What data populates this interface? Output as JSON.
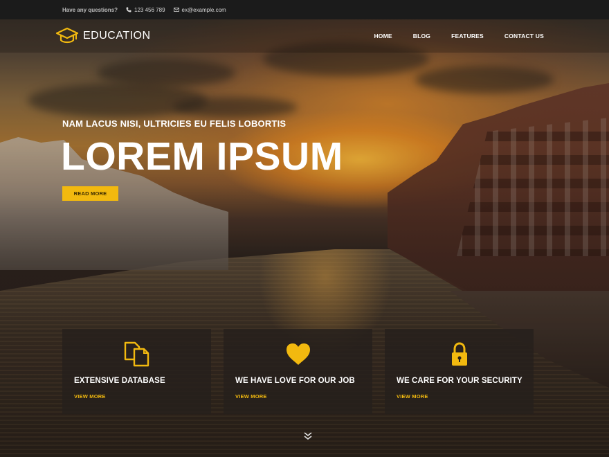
{
  "topbar": {
    "question": "Have any questions?",
    "phone": "123 456 789",
    "email": "ex@example.com",
    "icons": [
      "phone-icon",
      "envelope-icon"
    ]
  },
  "nav": {
    "brand": "EDUCATION",
    "brand_icon": "graduation-cap-icon",
    "items": [
      {
        "label": "HOME"
      },
      {
        "label": "BLOG"
      },
      {
        "label": "FEATURES"
      },
      {
        "label": "CONTACT US"
      }
    ]
  },
  "hero": {
    "subtitle": "NAM LACUS NISI, ULTRICIES EU FELIS LOBORTIS",
    "title": "LOREM IPSUM",
    "button": "READ MORE"
  },
  "features": [
    {
      "icon": "documents-icon",
      "title": "EXTENSIVE DATABASE",
      "link": "VIEW MORE"
    },
    {
      "icon": "heart-icon",
      "title": "WE HAVE LOVE FOR OUR JOB",
      "link": "VIEW MORE"
    },
    {
      "icon": "lock-icon",
      "title": "WE CARE FOR YOUR SECURITY",
      "link": "VIEW MORE"
    }
  ],
  "scroll_icon": "chevron-double-down-icon",
  "colors": {
    "accent": "#f2b90f",
    "topbar": "#1b1b1b",
    "feature_box": "#26201c"
  }
}
